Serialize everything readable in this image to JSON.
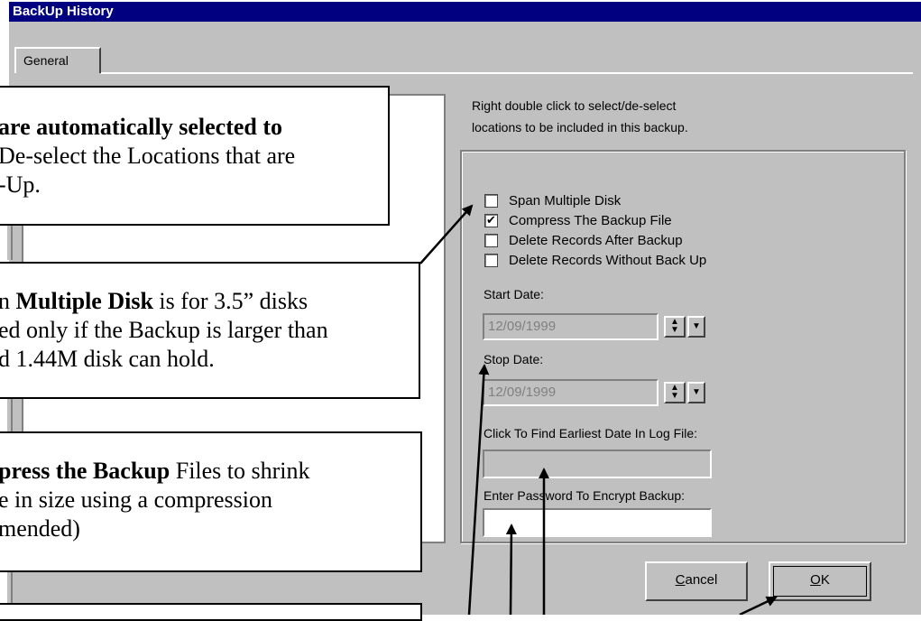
{
  "window": {
    "title": "BackUp History"
  },
  "tabs": [
    {
      "label": "General"
    }
  ],
  "hint": {
    "line1": "Right double click to select/de-select",
    "line2": "locations to be included in this backup."
  },
  "options": [
    {
      "label": "Span Multiple Disk",
      "checked": false,
      "mark": ""
    },
    {
      "label": "Compress The Backup File",
      "checked": true,
      "mark": "✔"
    },
    {
      "label": "Delete Records After Backup",
      "checked": false,
      "mark": ""
    },
    {
      "label": "Delete Records Without Back Up",
      "checked": false,
      "mark": ""
    }
  ],
  "start_date": {
    "label": "Start Date:",
    "value": "12/09/1999"
  },
  "stop_date": {
    "label": "Stop Date:",
    "value": "12/09/1999"
  },
  "earliest_date": {
    "label": "Click To Find Earliest Date In Log File:",
    "value": ""
  },
  "password": {
    "label": "Enter Password To Encrypt Backup:",
    "value": ""
  },
  "buttons": {
    "cancel": "Cancel",
    "ok": "OK"
  },
  "callouts": {
    "c1": {
      "line1_bold": "are automatically selected to",
      "line2": "De-select the Locations that are",
      "line3": "-Up."
    },
    "c2": {
      "line1_pre": "n ",
      "line1_bold": "Multiple Disk",
      "line1_post": " is for 3.5” disks",
      "line2": "ed only if the Backup is larger than",
      "line3": "d 1.44M disk can hold."
    },
    "c3": {
      "line1_bold": "press the Backup",
      "line1_post": " Files to shrink",
      "line2": "e in size using a compression",
      "line3": "mended)"
    }
  },
  "colors": {
    "titlebar": "#000080",
    "face": "#c0c0c0"
  }
}
